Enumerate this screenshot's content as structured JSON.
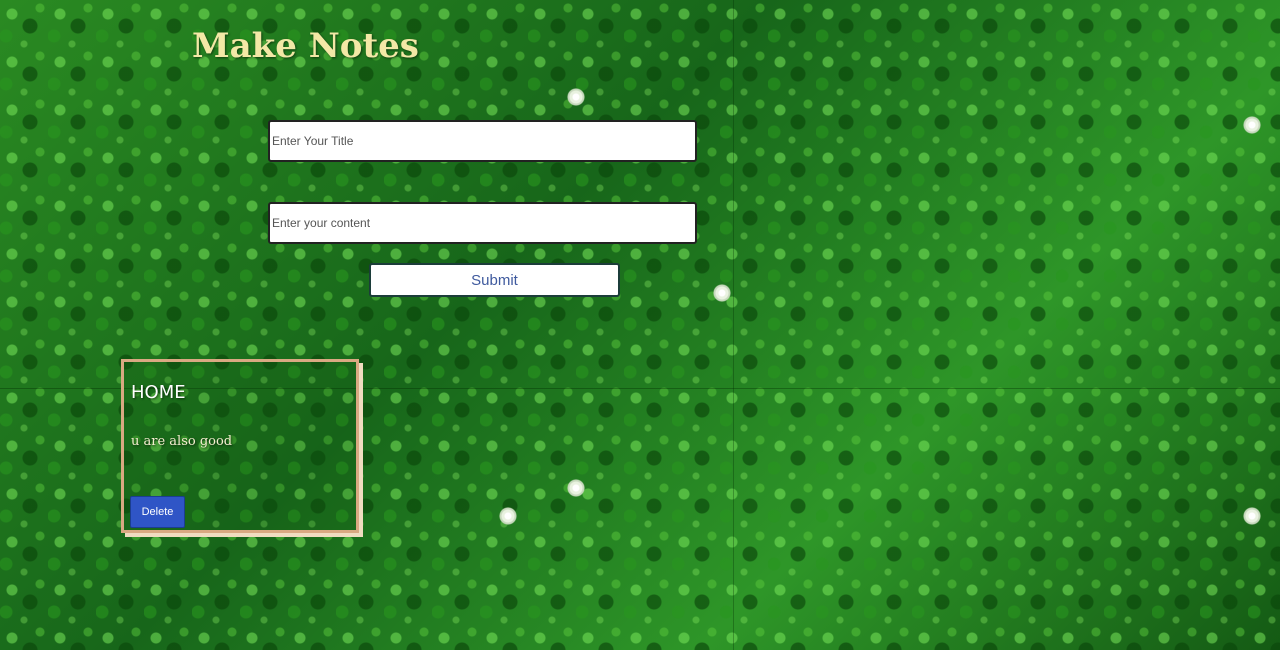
{
  "app": {
    "title": "Make Notes"
  },
  "form": {
    "title_placeholder": "Enter Your Title",
    "content_placeholder": "Enter your content",
    "title_value": "",
    "content_value": "",
    "submit_label": "Submit"
  },
  "notes": [
    {
      "title": "HOME",
      "content": "u are also good",
      "delete_label": "Delete"
    }
  ],
  "colors": {
    "background": "#1f7a1a",
    "title_text": "#f3e8a6",
    "submit_text": "#3f5a9e",
    "delete_button": "#2f55c6",
    "note_border": "#d9a982"
  }
}
